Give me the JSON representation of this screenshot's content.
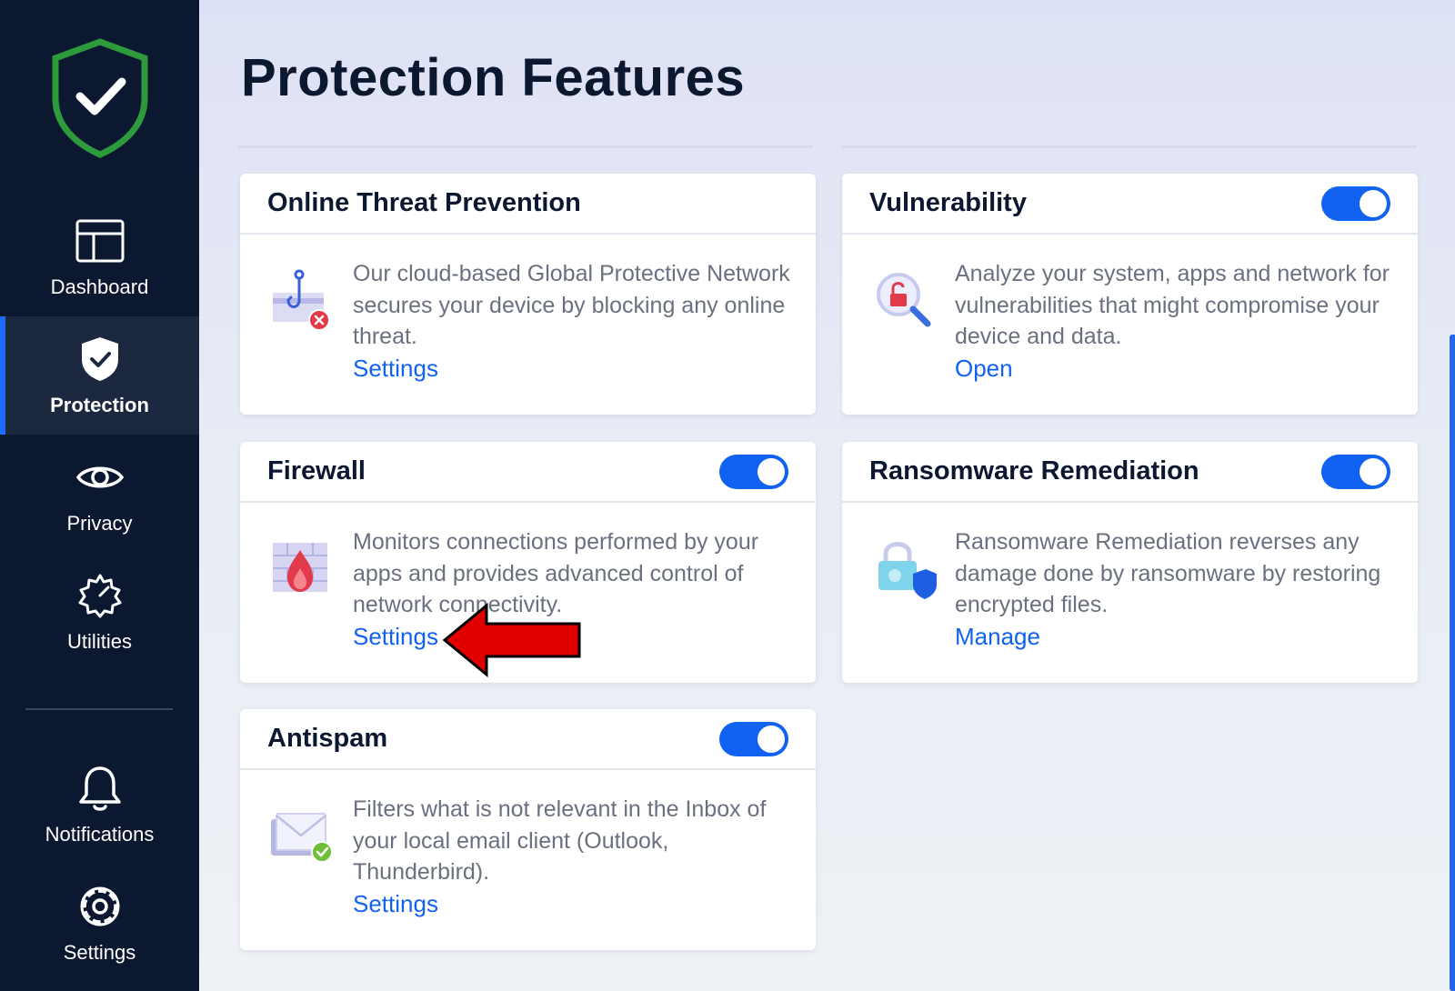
{
  "sidebar": {
    "items": [
      {
        "label": "Dashboard",
        "icon": "dashboard-icon"
      },
      {
        "label": "Protection",
        "icon": "shield-check-icon",
        "active": true
      },
      {
        "label": "Privacy",
        "icon": "eye-icon"
      },
      {
        "label": "Utilities",
        "icon": "utilities-gauge-icon"
      },
      {
        "label": "Notifications",
        "icon": "bell-icon"
      },
      {
        "label": "Settings",
        "icon": "gear-icon"
      }
    ]
  },
  "page": {
    "title": "Protection Features"
  },
  "cards": {
    "online_threat": {
      "title": "Online Threat Prevention",
      "description": "Our cloud-based Global Protective Network secures your device by blocking any online threat.",
      "link": "Settings",
      "icon": "phishing-hook-icon"
    },
    "vulnerability": {
      "title": "Vulnerability",
      "description": "Analyze your system, apps and network for vulnerabilities that might compromise your device and data.",
      "link": "Open",
      "toggle_on": true,
      "icon": "vulnerability-magnifier-icon"
    },
    "firewall": {
      "title": "Firewall",
      "description": "Monitors connections performed by your apps and provides advanced control of network connectivity.",
      "link": "Settings",
      "toggle_on": true,
      "icon": "firewall-icon"
    },
    "ransomware": {
      "title": "Ransomware Remediation",
      "description": "Ransomware Remediation reverses any damage done by ransomware by restoring encrypted files.",
      "link": "Manage",
      "toggle_on": true,
      "icon": "ransomware-lock-icon"
    },
    "antispam": {
      "title": "Antispam",
      "description": "Filters what is not relevant in the Inbox of your local email client (Outlook, Thunderbird).",
      "link": "Settings",
      "toggle_on": true,
      "icon": "antispam-envelope-icon"
    }
  },
  "colors": {
    "sidebar_bg": "#0c1730",
    "accent": "#1162f0",
    "logo_green": "#2d9a3b",
    "arrow_red": "#e00000"
  }
}
